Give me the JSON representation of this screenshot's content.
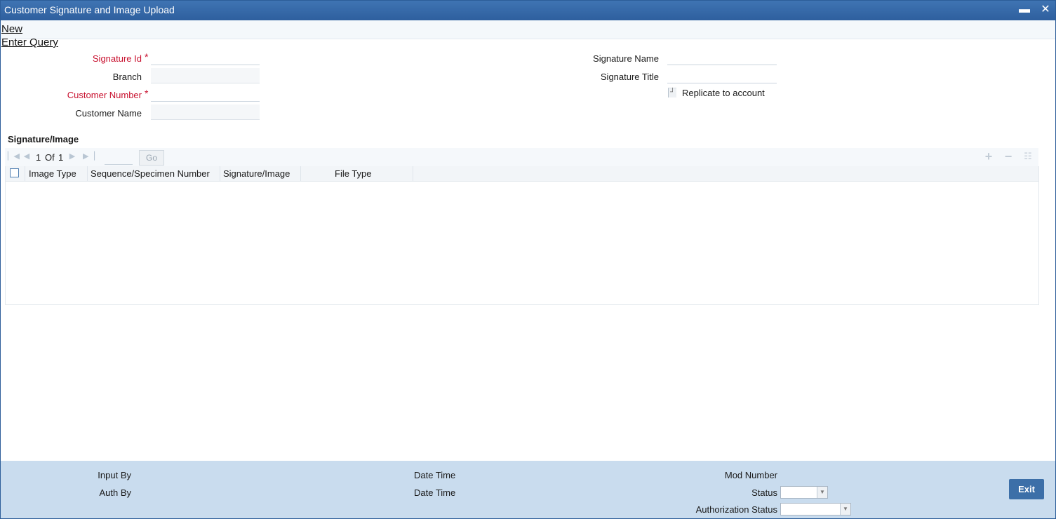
{
  "window": {
    "title": "Customer Signature and Image Upload",
    "minimize_glyph": "▬",
    "close_glyph": "✕"
  },
  "menu": {
    "new_label": "New",
    "enter_query_label": "Enter Query"
  },
  "form": {
    "signature_id_label": "Signature Id",
    "branch_label": "Branch",
    "customer_number_label": "Customer Number",
    "customer_name_label": "Customer Name",
    "signature_name_label": "Signature Name",
    "signature_title_label": "Signature Title",
    "replicate_label": "Replicate to account",
    "required_mark": "*",
    "signature_id_value": "",
    "branch_value": "",
    "customer_number_value": "",
    "customer_name_value": "",
    "signature_name_value": "",
    "signature_title_value": "",
    "replicate_checked": false
  },
  "grid": {
    "section_title": "Signature/Image",
    "pager": {
      "current": "1",
      "of_label": "Of",
      "total": "1",
      "go_label": "Go"
    },
    "columns": [
      "Image Type",
      "Sequence/Specimen Number",
      "Signature/Image",
      "File Type"
    ],
    "rows": [],
    "icons": {
      "first": "first-page-icon",
      "prev": "prev-page-icon",
      "next": "next-page-icon",
      "last": "last-page-icon",
      "add": "add-row-icon",
      "remove": "delete-row-icon",
      "view": "single-view-icon"
    }
  },
  "footer": {
    "input_by_label": "Input By",
    "auth_by_label": "Auth By",
    "date_time_label": "Date Time",
    "date_time2_label": "Date Time",
    "mod_number_label": "Mod Number",
    "status_label": "Status",
    "authorization_status_label": "Authorization Status",
    "status_value": "",
    "authorization_status_value": "",
    "exit_label": "Exit"
  },
  "colors": {
    "titlebar": "#2e5f9e",
    "required": "#c8102e",
    "footer_bg": "#c9dcee",
    "exit_button": "#3c6fa8"
  }
}
